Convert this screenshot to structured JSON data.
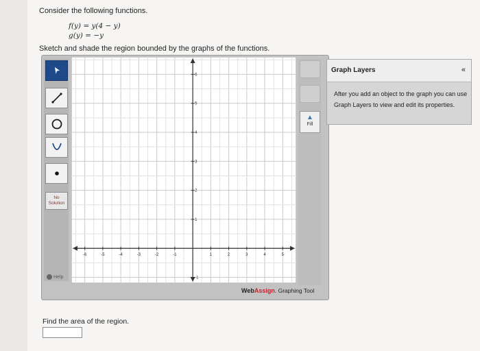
{
  "question": {
    "intro": "Consider the following functions.",
    "f_def": "f(y) = y(4 − y)",
    "g_def": "g(y) = −y",
    "instruction": "Sketch and shade the region bounded by the graphs of the functions.",
    "area_prompt": "Find the area of the region.",
    "answer_value": ""
  },
  "tools": {
    "items": [
      "pointer",
      "line",
      "circle",
      "parabola",
      "point"
    ],
    "no_solution_line1": "No",
    "no_solution_line2": "Solution",
    "help_label": "Help"
  },
  "side_tools": {
    "fill_label": "Fill"
  },
  "graph": {
    "x_ticks": [
      "-6",
      "-5",
      "-4",
      "-3",
      "-2",
      "-1",
      "1",
      "2",
      "3",
      "4",
      "5"
    ],
    "y_ticks": [
      "6",
      "5",
      "4",
      "3",
      "2",
      "1",
      "-1"
    ]
  },
  "brand": {
    "web": "Web",
    "assign": "Assign",
    "suffix": ". Graphing Tool"
  },
  "layers_panel": {
    "title": "Graph Layers",
    "collapse": "«",
    "description": "After you add an object to the graph you can use Graph Layers to view and edit its properties."
  },
  "colors": {
    "selected_tool": "#1f4a8a",
    "brand_accent": "#c8202b"
  }
}
